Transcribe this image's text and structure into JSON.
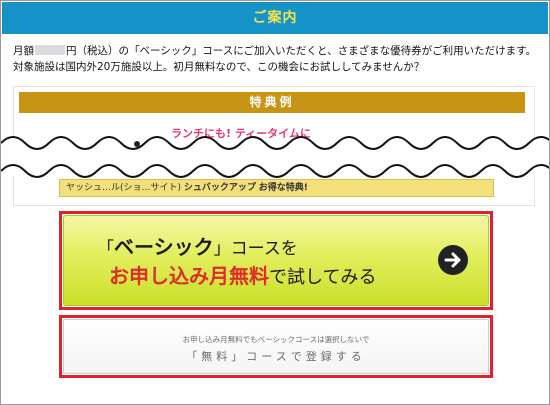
{
  "header": {
    "title": "ご案内"
  },
  "intro": {
    "line1_prefix": "月額",
    "line1_suffix": "円（税込）の「ベーシック」コースにご加入いただくと、さまざまな優待券がご利用いただけます。",
    "line2": "対象施設は国内外20万施設以上。初月無料なので、この機会にお試ししてみませんか？"
  },
  "benefits": {
    "title": "特典例",
    "snippet_top": "ランチにも! ティータイムに",
    "snippet_bottom_prefix": "ヤッシュ…ル(ショ…サイト)",
    "snippet_bottom_bold": "シュバックアップ",
    "snippet_bottom_suffix": "お得な特典!"
  },
  "cta_primary": {
    "line1_bracket_open": "「",
    "line1_emph": "ベーシック",
    "line1_bracket_close": "」",
    "line1_rest": "コースを",
    "line2_red": "お申し込み月無料",
    "line2_rest": "で試してみる",
    "icon": "arrow-right-circle-icon"
  },
  "cta_secondary": {
    "note": "お申し込み月無料でもベーシックコースは選択しないで",
    "label": "「無料」コースで登録する"
  },
  "colors": {
    "header_bg": "#1592c8",
    "header_text": "#f3e24a",
    "benefit_title_bg": "#c89414",
    "highlight_border": "#e0212e",
    "cta_red_text": "#e02b2b"
  }
}
